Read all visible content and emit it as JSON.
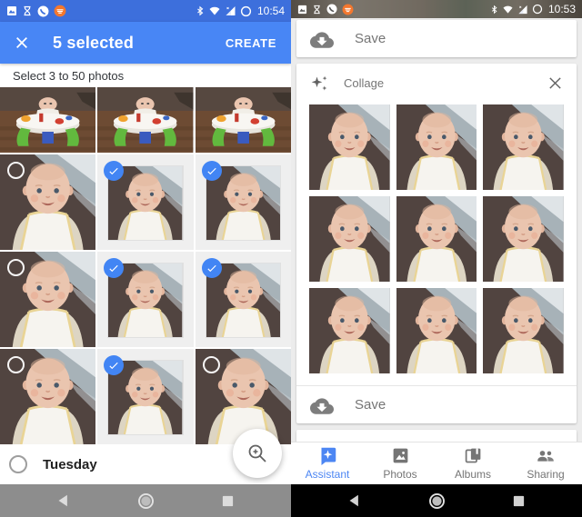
{
  "left_screen": {
    "status_bar": {
      "time": "10:54"
    },
    "selection_bar": {
      "title": "5 selected",
      "action": "CREATE"
    },
    "instruction": "Select 3 to 50 photos",
    "grid": {
      "cells": [
        {
          "photo": "bouncer",
          "badge": "none"
        },
        {
          "photo": "bouncer",
          "badge": "none"
        },
        {
          "photo": "bouncer",
          "badge": "none"
        },
        {
          "photo": "face",
          "badge": "circle"
        },
        {
          "photo": "face",
          "badge": "check"
        },
        {
          "photo": "face",
          "badge": "check"
        },
        {
          "photo": "face",
          "badge": "circle"
        },
        {
          "photo": "face",
          "badge": "check"
        },
        {
          "photo": "face",
          "badge": "check"
        },
        {
          "photo": "face",
          "badge": "circle"
        },
        {
          "photo": "face",
          "badge": "check"
        },
        {
          "photo": "face",
          "badge": "circle"
        }
      ]
    },
    "date_row": {
      "label": "Tuesday"
    }
  },
  "right_screen": {
    "status_bar": {
      "time": "10:53"
    },
    "save_card": {
      "label": "Save"
    },
    "collage_card": {
      "title": "Collage",
      "save_label": "Save",
      "photo_count": 9
    },
    "bottom_nav": {
      "items": [
        {
          "label": "Assistant",
          "active": true
        },
        {
          "label": "Photos",
          "active": false
        },
        {
          "label": "Albums",
          "active": false
        },
        {
          "label": "Sharing",
          "active": false
        }
      ]
    }
  },
  "colors": {
    "accent_blue": "#4285f4",
    "appbar_blue": "#4886f5",
    "statusbar_blue": "#3d6fdc",
    "icon_gray": "#757575"
  }
}
